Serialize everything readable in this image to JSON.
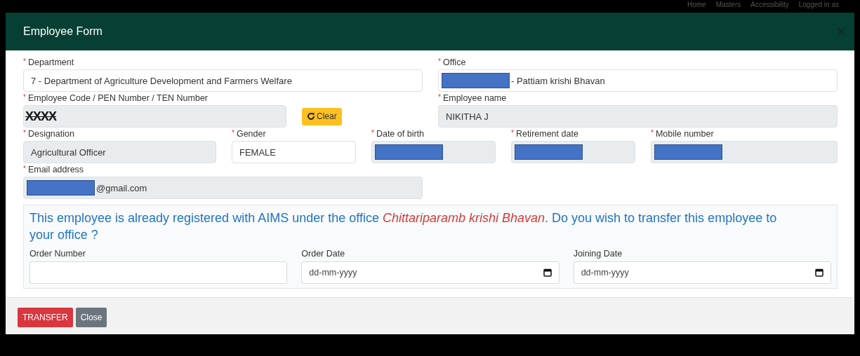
{
  "top_nav": [
    "Home",
    "Masters",
    "Accessibility",
    "Logged in as"
  ],
  "modal": {
    "title": "Employee Form"
  },
  "rows": [
    [
      {
        "kind": "text",
        "label": "Department",
        "marker": "*",
        "value": "7 - Department of Agriculture Development and Farmers Welfare",
        "readonly": false
      },
      {
        "kind": "redacted_prefix",
        "label": "Office",
        "marker": "*",
        "value": "- Pattiam krishi Bhavan",
        "readonly": false
      }
    ],
    [
      {
        "kind": "code",
        "label": "Employee Code / PEN Number / TEN Number",
        "marker": "*",
        "value": "XXXX",
        "readonly": true,
        "button": "Clear"
      },
      {
        "kind": "text",
        "label": "Employee name",
        "marker": "*",
        "value": "NIKITHA J",
        "readonly": true
      }
    ],
    [
      {
        "kind": "text",
        "label": "Designation",
        "marker": "*",
        "value": "Agricultural Officer",
        "readonly": true
      },
      {
        "kind": "text",
        "label": "Gender",
        "marker": "*",
        "value": "FEMALE",
        "readonly": false
      },
      {
        "kind": "redacted",
        "label": "Date of birth",
        "marker": "*",
        "readonly": true
      },
      {
        "kind": "redacted",
        "label": "Retirement date",
        "marker": "*",
        "readonly": true
      },
      {
        "kind": "redacted",
        "label": "Mobile number",
        "marker": "*",
        "readonly": true
      }
    ],
    [
      {
        "kind": "redacted_prefix",
        "label": "Email address",
        "marker": "*",
        "value": "@gmail.com",
        "readonly": true
      }
    ]
  ],
  "transfer": {
    "message": "This employee is already registered with AIMS under the office *Chittariparamb krishi Bhavan*. Do you wish to transfer this employee to your office ?",
    "fields": [
      {
        "kind": "text",
        "label": "Order Number"
      },
      {
        "kind": "date",
        "label": "Order Date",
        "placeholder": "dd-mm-yyyy"
      },
      {
        "kind": "date",
        "label": "Joining Date",
        "placeholder": "dd-mm-yyyy"
      }
    ]
  },
  "buttons": [
    {
      "kind": "danger",
      "label": "TRANSFER"
    },
    {
      "kind": "secondary",
      "label": "Close"
    }
  ]
}
